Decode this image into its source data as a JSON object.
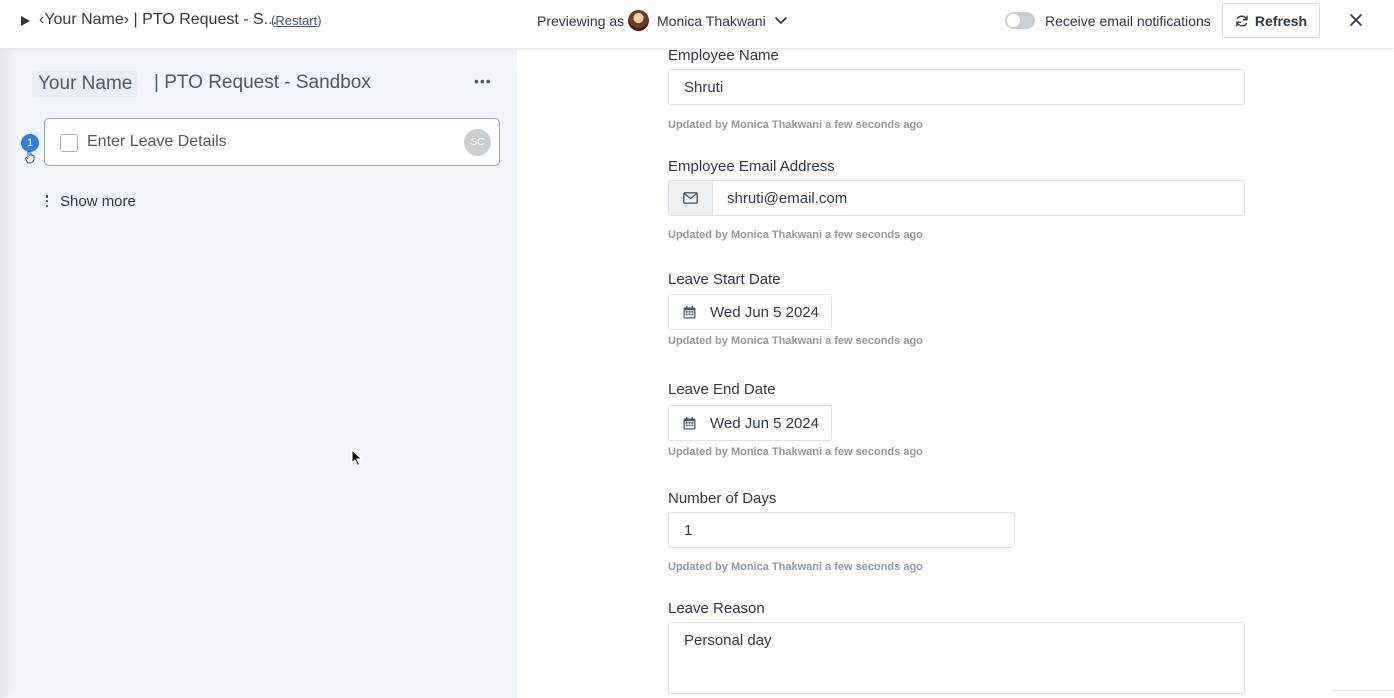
{
  "topbar": {
    "workflow_title": "‹Your Name› | PTO Request - S...",
    "restart_label": "Restart",
    "previewing_as_label": "Previewing as",
    "preview_user": "Monica Thakwani",
    "notifications_label": "Receive email notifications",
    "notifications_enabled": false,
    "refresh_label": "Refresh"
  },
  "left_panel": {
    "name_chip": "Your Name",
    "title": "| PTO Request - Sandbox",
    "tasks": [
      {
        "step": "1",
        "label": "Enter Leave Details",
        "assignee_initials": "SC",
        "completed": false
      }
    ],
    "show_more_label": "Show more"
  },
  "form": {
    "fields": [
      {
        "label": "Employee Name",
        "value": "Shruti",
        "meta": "Updated by Monica Thakwani a few seconds ago"
      },
      {
        "label": "Employee Email Address",
        "value": "shruti@email.com",
        "meta": "Updated by Monica Thakwani a few seconds ago"
      },
      {
        "label": "Leave Start Date",
        "value": "Wed Jun 5 2024",
        "meta": "Updated by Monica Thakwani a few seconds ago"
      },
      {
        "label": "Leave End Date",
        "value": "Wed Jun 5 2024",
        "meta": "Updated by Monica Thakwani a few seconds ago"
      },
      {
        "label": "Number of Days",
        "value": "1",
        "meta": "Updated by Monica Thakwani a few seconds ago"
      },
      {
        "label": "Leave Reason",
        "value": "Personal day"
      }
    ]
  },
  "icons": {
    "play": "play-icon",
    "chevron": "chevron-down-icon",
    "refresh": "refresh-icon",
    "close": "close-icon",
    "email": "envelope-icon",
    "calendar": "calendar-icon",
    "kebab": "kebab-icon",
    "hand": "hand-pointer-icon"
  },
  "colors": {
    "accent": "#2f7fd8",
    "left_panel_bg": "#f1f5f9",
    "text": "#2f3a45",
    "meta_text": "#8f9aa5"
  }
}
